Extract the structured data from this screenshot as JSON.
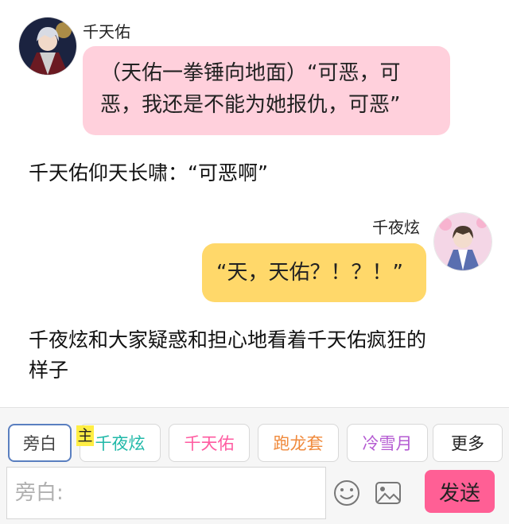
{
  "messages": {
    "left": {
      "sender": "千天佑",
      "text": "（天佑一拳锤向地面）“可恶，可恶，我还是不能为她报仇，可恶”"
    },
    "narration_1": "千天佑仰天长啸：“可恶啊”",
    "right": {
      "sender": "千夜炫",
      "text": "“天，天佑？！？！”"
    },
    "narration_2_line1": "千夜炫和大家疑惑和担心地看着千天佑疯狂的",
    "narration_2_line2": "样子"
  },
  "role_bar": {
    "chips": [
      {
        "label": "旁白",
        "color": "#555555"
      },
      {
        "label": "千夜炫",
        "color": "#1fb8a8"
      },
      {
        "label": "千天佑",
        "color": "#ff5aa0"
      },
      {
        "label": "跑龙套",
        "color": "#f08a3c"
      },
      {
        "label": "冷雪月",
        "color": "#b45ad2"
      },
      {
        "label": "更多",
        "color": "#333333"
      }
    ],
    "main_badge": "主"
  },
  "composer": {
    "placeholder": "旁白:",
    "send_label": "发送",
    "icons": [
      "emoji-icon",
      "image-icon"
    ]
  }
}
